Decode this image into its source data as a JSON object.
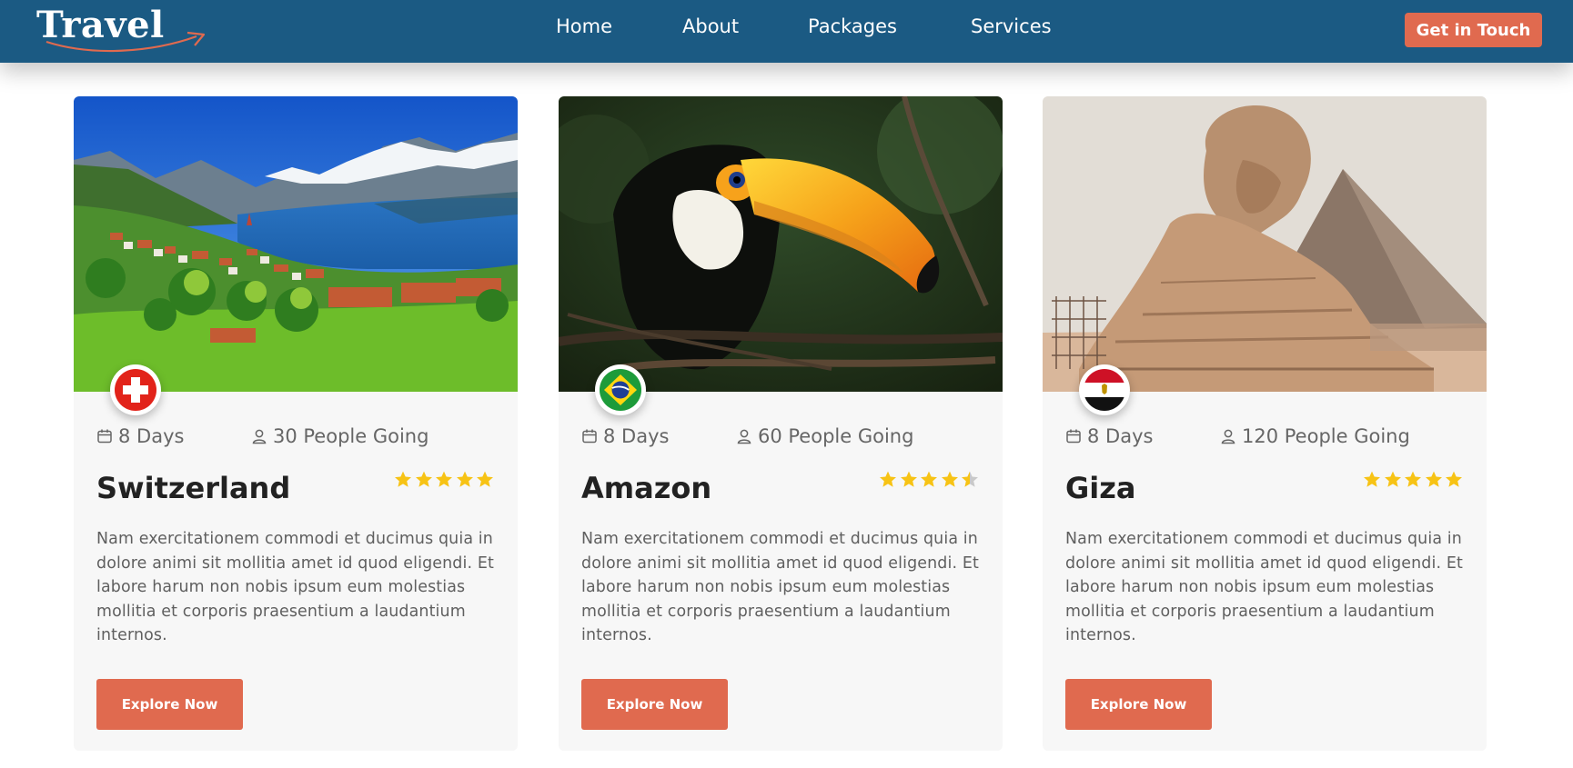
{
  "header": {
    "logo_text": "Travel",
    "nav": [
      {
        "label": "Home"
      },
      {
        "label": "About"
      },
      {
        "label": "Packages"
      },
      {
        "label": "Services"
      }
    ],
    "cta_label": "Get in Touch",
    "colors": {
      "bar": "#1b5a83",
      "accent": "#e06a4f"
    }
  },
  "cards": [
    {
      "image": "lake-village-alps",
      "flag_icon": "switzerland-flag-icon",
      "days": "8 Days",
      "people": "30 People Going",
      "title": "Switzerland",
      "rating": 5,
      "description": "Nam exercitationem commodi et ducimus quia in dolore animi sit mollitia amet id quod eligendi. Et labore harum non nobis ipsum eum molestias mollitia et corporis praesentium a laudantium internos.",
      "button": "Explore Now"
    },
    {
      "image": "toucan-bird",
      "flag_icon": "brazil-flag-icon",
      "days": "8 Days",
      "people": "60 People Going",
      "title": "Amazon",
      "rating": 4.5,
      "description": "Nam exercitationem commodi et ducimus quia in dolore animi sit mollitia amet id quod eligendi. Et labore harum non nobis ipsum eum molestias mollitia et corporis praesentium a laudantium internos.",
      "button": "Explore Now"
    },
    {
      "image": "great-sphinx",
      "flag_icon": "egypt-flag-icon",
      "days": "8 Days",
      "people": "120 People Going",
      "title": "Giza",
      "rating": 5,
      "description": "Nam exercitationem commodi et ducimus quia in dolore animi sit mollitia amet id quod eligendi. Et labore harum non nobis ipsum eum molestias mollitia et corporis praesentium a laudantium internos.",
      "button": "Explore Now"
    }
  ]
}
